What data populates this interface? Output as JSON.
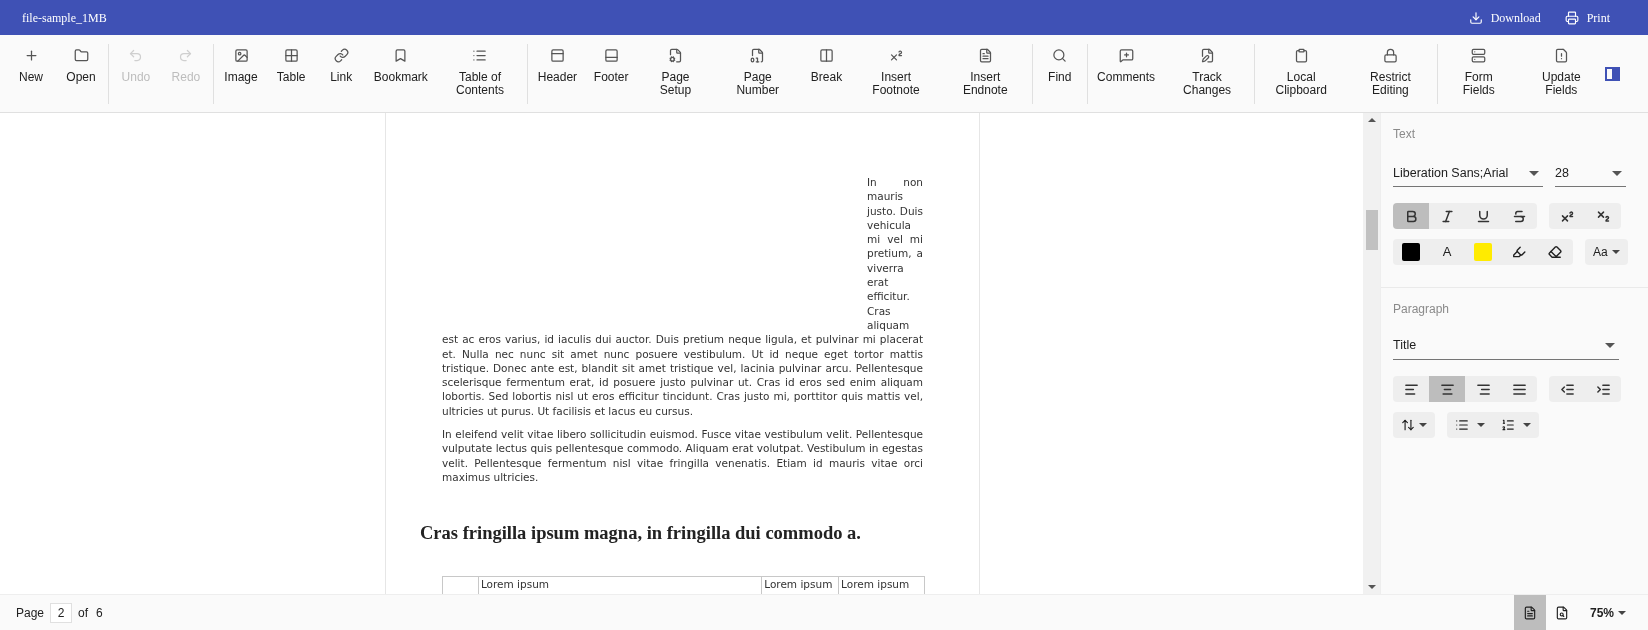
{
  "title_bar": {
    "title": "file-sample_1MB",
    "actions": [
      {
        "label": "Download"
      },
      {
        "label": "Print"
      }
    ]
  },
  "toolbar": {
    "groups": [
      [
        {
          "label": "New",
          "disabled": false
        },
        {
          "label": "Open",
          "disabled": false
        }
      ],
      [
        {
          "label": "Undo",
          "disabled": true
        },
        {
          "label": "Redo",
          "disabled": true
        }
      ],
      [
        {
          "label": "Image",
          "disabled": false
        },
        {
          "label": "Table",
          "disabled": false
        },
        {
          "label": "Link",
          "disabled": false
        },
        {
          "label": "Bookmark",
          "disabled": false
        },
        {
          "label": "Table of Contents",
          "disabled": false
        }
      ],
      [
        {
          "label": "Header",
          "disabled": false
        },
        {
          "label": "Footer",
          "disabled": false
        },
        {
          "label": "Page Setup",
          "disabled": false
        },
        {
          "label": "Page Number",
          "disabled": false
        },
        {
          "label": "Break",
          "disabled": false
        },
        {
          "label": "Insert Footnote",
          "disabled": false
        },
        {
          "label": "Insert Endnote",
          "disabled": false
        }
      ],
      [
        {
          "label": "Find",
          "disabled": false
        }
      ],
      [
        {
          "label": "Comments",
          "disabled": false
        },
        {
          "label": "Track Changes",
          "disabled": false
        }
      ],
      [
        {
          "label": "Local Clipboard",
          "disabled": false
        },
        {
          "label": "Restrict Editing",
          "disabled": false
        }
      ],
      [
        {
          "label": "Form Fields",
          "disabled": false
        },
        {
          "label": "Update Fields",
          "disabled": false
        }
      ]
    ]
  },
  "document": {
    "paragraphs": [
      {
        "kind": "wrapped",
        "text": "In non mauris justo. Duis vehicula mi vel mi pretium, a viverra erat efficitur. Cras aliquam est ac eros varius, id iaculis dui auctor. Duis pretium neque ligula, et pulvinar mi placerat et. Nulla nec nunc sit amet nunc posuere vestibulum. Ut id neque eget tortor mattis tristique. Donec ante est, blandit sit amet tristique vel, lacinia pulvinar arcu. Pellentesque scelerisque fermentum erat, id posuere justo pulvinar ut. Cras id eros sed enim aliquam lobortis. Sed lobortis nisl ut eros efficitur tincidunt. Cras justo mi, porttitor quis mattis vel, ultricies ut purus. Ut facilisis et lacus eu cursus."
      },
      {
        "kind": "body",
        "text": "In eleifend velit vitae libero sollicitudin euismod. Fusce vitae vestibulum velit. Pellentesque vulputate lectus quis pellentesque commodo. Aliquam erat volutpat. Vestibulum in egestas velit. Pellentesque fermentum nisl vitae fringilla venenatis. Etiam id mauris vitae orci maximus ultricies."
      },
      {
        "kind": "heading",
        "text": "Cras fringilla ipsum magna, in fringilla dui commodo a."
      }
    ],
    "table": {
      "rows": [
        {
          "cells": [
            "",
            "Lorem ipsum",
            "Lorem ipsum",
            "Lorem ipsum"
          ]
        }
      ]
    }
  },
  "properties": {
    "text": {
      "title": "Text",
      "font": "Liberation Sans;Arial",
      "size": "28",
      "formats": [
        {
          "selected": true
        },
        {
          "selected": false
        },
        {
          "selected": false
        },
        {
          "selected": false
        }
      ],
      "scripts": [
        {
          "selected": false
        },
        {
          "selected": false
        }
      ],
      "color_tools": [
        {
          "kind": "swatch",
          "color": "#000000"
        },
        {
          "kind": "glyph",
          "text": "A"
        },
        {
          "kind": "swatch",
          "color": "#ffeb00"
        },
        {
          "kind": "icon"
        },
        {
          "kind": "icon"
        }
      ],
      "change_case": "Aa"
    },
    "paragraph": {
      "title": "Paragraph",
      "style": "Title",
      "alignments": [
        {
          "selected": false
        },
        {
          "selected": true
        },
        {
          "selected": false
        },
        {
          "selected": false
        }
      ],
      "indents": [
        {
          "selected": false
        },
        {
          "selected": false
        }
      ]
    }
  },
  "status_bar": {
    "page_label": "Page",
    "page": "2",
    "of_label": "of",
    "total": "6",
    "views": [
      {
        "selected": true
      },
      {
        "selected": false
      }
    ],
    "zoom": "75%"
  }
}
